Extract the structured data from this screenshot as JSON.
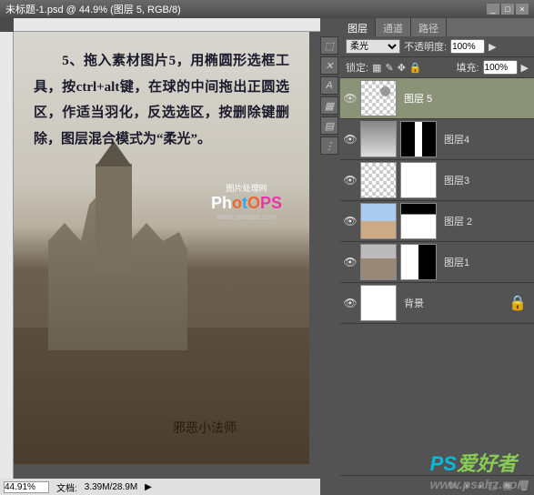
{
  "title": "未标题-1.psd @ 44.9% (图层 5, RGB/8)",
  "instruction": "　　5、拖入素材图片5，用椭圆形选框工具，按ctrl+alt键，在球的中间拖出正圆选区，作适当羽化，反选选区，按删除键删除，图层混合模式为“柔光”。",
  "logo": {
    "brand_label": "图片处理网",
    "name_ph": "Ph",
    "name_o": "o",
    "name_t": "t",
    "name_o2": "O",
    "name_ps": "PS",
    "url": "www.photops.com"
  },
  "status": {
    "zoom": "44.91%",
    "doc_label": "文档:",
    "doc_size": "3.39M/28.9M"
  },
  "tools": [
    "⬚",
    "✕",
    "A",
    "▦",
    "▤",
    "⋮"
  ],
  "panel": {
    "tabs": {
      "layers": "图层",
      "channels": "通道",
      "paths": "路径"
    },
    "blend": "柔光",
    "opacity_label": "不透明度:",
    "opacity": "100%",
    "lock_label": "锁定:",
    "fill_label": "填充:",
    "fill": "100%"
  },
  "layers": [
    {
      "name": "图层 5",
      "selected": true,
      "visible": true,
      "thumb": "moon",
      "mask": null
    },
    {
      "name": "图层4",
      "selected": false,
      "visible": true,
      "thumb": "sky",
      "mask": "m2"
    },
    {
      "name": "图层3",
      "selected": false,
      "visible": true,
      "thumb": "trans",
      "mask": "mask"
    },
    {
      "name": "图层 2",
      "selected": false,
      "visible": true,
      "thumb": "sea",
      "mask": "m3"
    },
    {
      "name": "图层1",
      "selected": false,
      "visible": true,
      "thumb": "cas",
      "mask": "m4"
    },
    {
      "name": "背景",
      "selected": false,
      "visible": true,
      "thumb": "mask",
      "mask": null,
      "locked": true
    }
  ],
  "watermark": {
    "p": "PS",
    "s": "爱好者",
    "url": "www.psahz.com"
  },
  "stamp": "邪恶小法师"
}
